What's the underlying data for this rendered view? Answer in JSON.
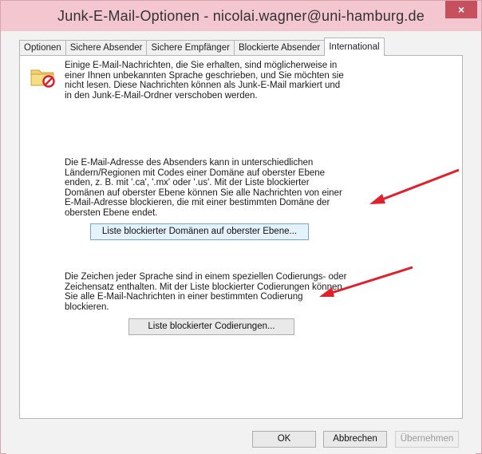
{
  "window": {
    "title": "Junk-E-Mail-Optionen - nicolai.wagner@uni-hamburg.de",
    "close_glyph": "×"
  },
  "tabs": [
    {
      "label": "Optionen",
      "active": false
    },
    {
      "label": "Sichere Absender",
      "active": false
    },
    {
      "label": "Sichere Empfänger",
      "active": false
    },
    {
      "label": "Blockierte Absender",
      "active": false
    },
    {
      "label": "International",
      "active": true
    }
  ],
  "panel": {
    "intro_text": "Einige E-Mail-Nachrichten, die Sie erhalten, sind möglicherweise in\neiner Ihnen unbekannten Sprache geschrieben, und Sie möchten sie\nnicht lesen. Diese Nachrichten können als Junk-E-Mail markiert und\nin den Junk-E-Mail-Ordner verschoben werden.",
    "domains_text": "Die E-Mail-Adresse des Absenders kann in unterschiedlichen\nLändern/Regionen mit Codes einer Domäne auf oberster Ebene\nenden, z. B. mit '.ca', '.mx' oder '.us'. Mit der Liste blockierter\nDomänen auf oberster Ebene können Sie alle Nachrichten von einer\nE-Mail-Adresse blockieren, die mit einer bestimmten Domäne der\nobersten Ebene endet.",
    "domains_button": "Liste blockierter Domänen auf oberster Ebene...",
    "encodings_text": "Die Zeichen jeder Sprache sind in einem speziellen Codierungs- oder\nZeichensatz enthalten. Mit der Liste blockierter Codierungen können\nSie alle E-Mail-Nachrichten in einer bestimmten Codierung\nblockieren.",
    "encodings_button": "Liste blockierter Codierungen..."
  },
  "footer": {
    "ok": "OK",
    "cancel": "Abbrechen",
    "apply": "Übernehmen"
  },
  "colors": {
    "titlebar": "#f3c6d0",
    "close_button": "#c7505f",
    "annotation_arrow": "#e0202a"
  },
  "icons": {
    "panel_icon": "blocked-folder-icon",
    "annotation": "red-arrow-icon"
  }
}
